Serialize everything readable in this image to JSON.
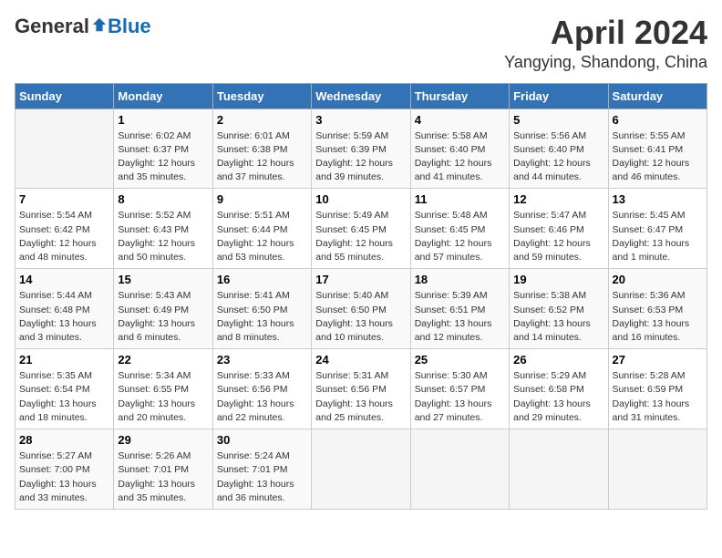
{
  "logo": {
    "general": "General",
    "blue": "Blue"
  },
  "title": "April 2024",
  "location": "Yangying, Shandong, China",
  "days_header": [
    "Sunday",
    "Monday",
    "Tuesday",
    "Wednesday",
    "Thursday",
    "Friday",
    "Saturday"
  ],
  "weeks": [
    [
      {
        "day": "",
        "info": ""
      },
      {
        "day": "1",
        "info": "Sunrise: 6:02 AM\nSunset: 6:37 PM\nDaylight: 12 hours\nand 35 minutes."
      },
      {
        "day": "2",
        "info": "Sunrise: 6:01 AM\nSunset: 6:38 PM\nDaylight: 12 hours\nand 37 minutes."
      },
      {
        "day": "3",
        "info": "Sunrise: 5:59 AM\nSunset: 6:39 PM\nDaylight: 12 hours\nand 39 minutes."
      },
      {
        "day": "4",
        "info": "Sunrise: 5:58 AM\nSunset: 6:40 PM\nDaylight: 12 hours\nand 41 minutes."
      },
      {
        "day": "5",
        "info": "Sunrise: 5:56 AM\nSunset: 6:40 PM\nDaylight: 12 hours\nand 44 minutes."
      },
      {
        "day": "6",
        "info": "Sunrise: 5:55 AM\nSunset: 6:41 PM\nDaylight: 12 hours\nand 46 minutes."
      }
    ],
    [
      {
        "day": "7",
        "info": "Sunrise: 5:54 AM\nSunset: 6:42 PM\nDaylight: 12 hours\nand 48 minutes."
      },
      {
        "day": "8",
        "info": "Sunrise: 5:52 AM\nSunset: 6:43 PM\nDaylight: 12 hours\nand 50 minutes."
      },
      {
        "day": "9",
        "info": "Sunrise: 5:51 AM\nSunset: 6:44 PM\nDaylight: 12 hours\nand 53 minutes."
      },
      {
        "day": "10",
        "info": "Sunrise: 5:49 AM\nSunset: 6:45 PM\nDaylight: 12 hours\nand 55 minutes."
      },
      {
        "day": "11",
        "info": "Sunrise: 5:48 AM\nSunset: 6:45 PM\nDaylight: 12 hours\nand 57 minutes."
      },
      {
        "day": "12",
        "info": "Sunrise: 5:47 AM\nSunset: 6:46 PM\nDaylight: 12 hours\nand 59 minutes."
      },
      {
        "day": "13",
        "info": "Sunrise: 5:45 AM\nSunset: 6:47 PM\nDaylight: 13 hours\nand 1 minute."
      }
    ],
    [
      {
        "day": "14",
        "info": "Sunrise: 5:44 AM\nSunset: 6:48 PM\nDaylight: 13 hours\nand 3 minutes."
      },
      {
        "day": "15",
        "info": "Sunrise: 5:43 AM\nSunset: 6:49 PM\nDaylight: 13 hours\nand 6 minutes."
      },
      {
        "day": "16",
        "info": "Sunrise: 5:41 AM\nSunset: 6:50 PM\nDaylight: 13 hours\nand 8 minutes."
      },
      {
        "day": "17",
        "info": "Sunrise: 5:40 AM\nSunset: 6:50 PM\nDaylight: 13 hours\nand 10 minutes."
      },
      {
        "day": "18",
        "info": "Sunrise: 5:39 AM\nSunset: 6:51 PM\nDaylight: 13 hours\nand 12 minutes."
      },
      {
        "day": "19",
        "info": "Sunrise: 5:38 AM\nSunset: 6:52 PM\nDaylight: 13 hours\nand 14 minutes."
      },
      {
        "day": "20",
        "info": "Sunrise: 5:36 AM\nSunset: 6:53 PM\nDaylight: 13 hours\nand 16 minutes."
      }
    ],
    [
      {
        "day": "21",
        "info": "Sunrise: 5:35 AM\nSunset: 6:54 PM\nDaylight: 13 hours\nand 18 minutes."
      },
      {
        "day": "22",
        "info": "Sunrise: 5:34 AM\nSunset: 6:55 PM\nDaylight: 13 hours\nand 20 minutes."
      },
      {
        "day": "23",
        "info": "Sunrise: 5:33 AM\nSunset: 6:56 PM\nDaylight: 13 hours\nand 22 minutes."
      },
      {
        "day": "24",
        "info": "Sunrise: 5:31 AM\nSunset: 6:56 PM\nDaylight: 13 hours\nand 25 minutes."
      },
      {
        "day": "25",
        "info": "Sunrise: 5:30 AM\nSunset: 6:57 PM\nDaylight: 13 hours\nand 27 minutes."
      },
      {
        "day": "26",
        "info": "Sunrise: 5:29 AM\nSunset: 6:58 PM\nDaylight: 13 hours\nand 29 minutes."
      },
      {
        "day": "27",
        "info": "Sunrise: 5:28 AM\nSunset: 6:59 PM\nDaylight: 13 hours\nand 31 minutes."
      }
    ],
    [
      {
        "day": "28",
        "info": "Sunrise: 5:27 AM\nSunset: 7:00 PM\nDaylight: 13 hours\nand 33 minutes."
      },
      {
        "day": "29",
        "info": "Sunrise: 5:26 AM\nSunset: 7:01 PM\nDaylight: 13 hours\nand 35 minutes."
      },
      {
        "day": "30",
        "info": "Sunrise: 5:24 AM\nSunset: 7:01 PM\nDaylight: 13 hours\nand 36 minutes."
      },
      {
        "day": "",
        "info": ""
      },
      {
        "day": "",
        "info": ""
      },
      {
        "day": "",
        "info": ""
      },
      {
        "day": "",
        "info": ""
      }
    ]
  ]
}
